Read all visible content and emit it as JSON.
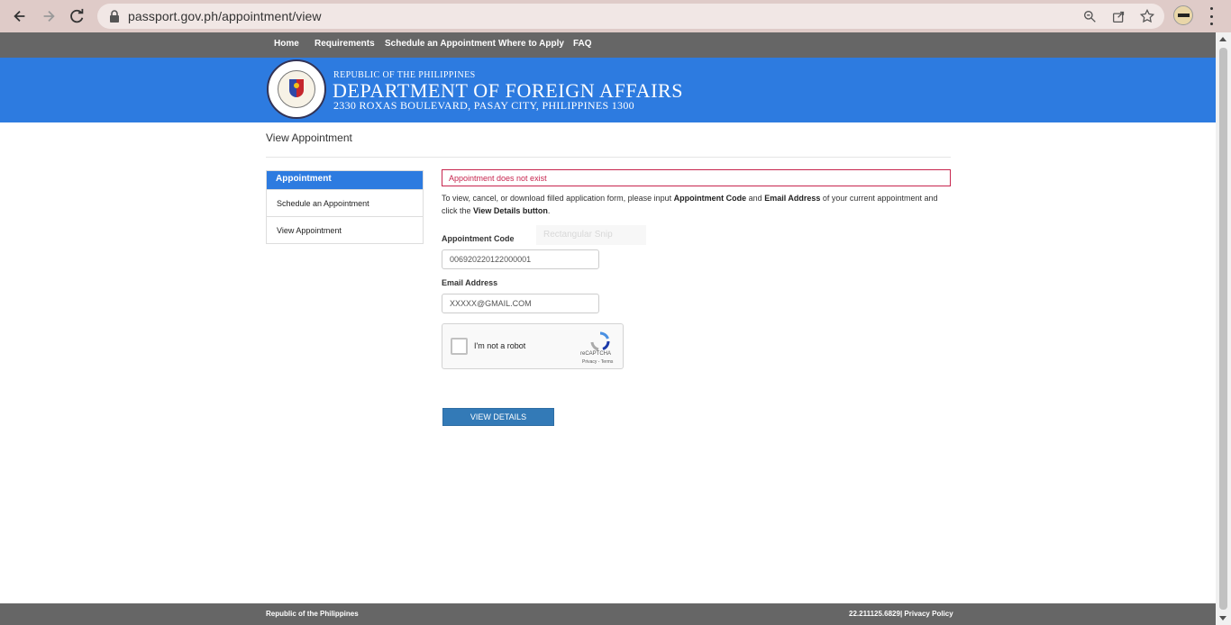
{
  "browser": {
    "url": "passport.gov.ph/appointment/view"
  },
  "topnav": {
    "items": [
      "Home",
      "Requirements",
      "Schedule an Appointment",
      "Where to Apply",
      "FAQ"
    ]
  },
  "banner": {
    "small_title": "REPUBLIC OF THE PHILIPPINES",
    "title": "DEPARTMENT OF FOREIGN AFFAIRS",
    "address": "2330 ROXAS BOULEVARD, PASAY CITY, PHILIPPINES 1300",
    "seal_text": "DEPARTMENT OF FOREIGN AFFAIRS · PHILIPPINES"
  },
  "page": {
    "heading": "View Appointment"
  },
  "sidebar": {
    "header": "Appointment",
    "items": [
      "Schedule an Appointment",
      "View Appointment"
    ]
  },
  "alert": {
    "message": "Appointment does not exist"
  },
  "instructions": {
    "part1": "To view, cancel, or download filled application form, please input ",
    "bold1": "Appointment Code",
    "part2": " and ",
    "bold2": "Email Address",
    "part3": " of your current appointment and click the ",
    "bold3": "View Details button",
    "part4": "."
  },
  "overlay": {
    "snip_text": "Rectangular Snip"
  },
  "form": {
    "code_label": "Appointment Code",
    "code_value": "006920220122000001",
    "email_label": "Email Address",
    "email_value": "XXXXX@GMAIL.COM"
  },
  "captcha": {
    "label": "I'm not a robot",
    "brand": "reCAPTCHA",
    "terms": "Privacy - Terms"
  },
  "button": {
    "view_details": "VIEW DETAILS"
  },
  "footer": {
    "left": "Republic of the Philippines",
    "right": "22.211125.6829| Privacy Policy"
  },
  "colors": {
    "banner": "#2d7be0",
    "nav": "#666666",
    "alert": "#c7254e",
    "button": "#337ab7"
  }
}
